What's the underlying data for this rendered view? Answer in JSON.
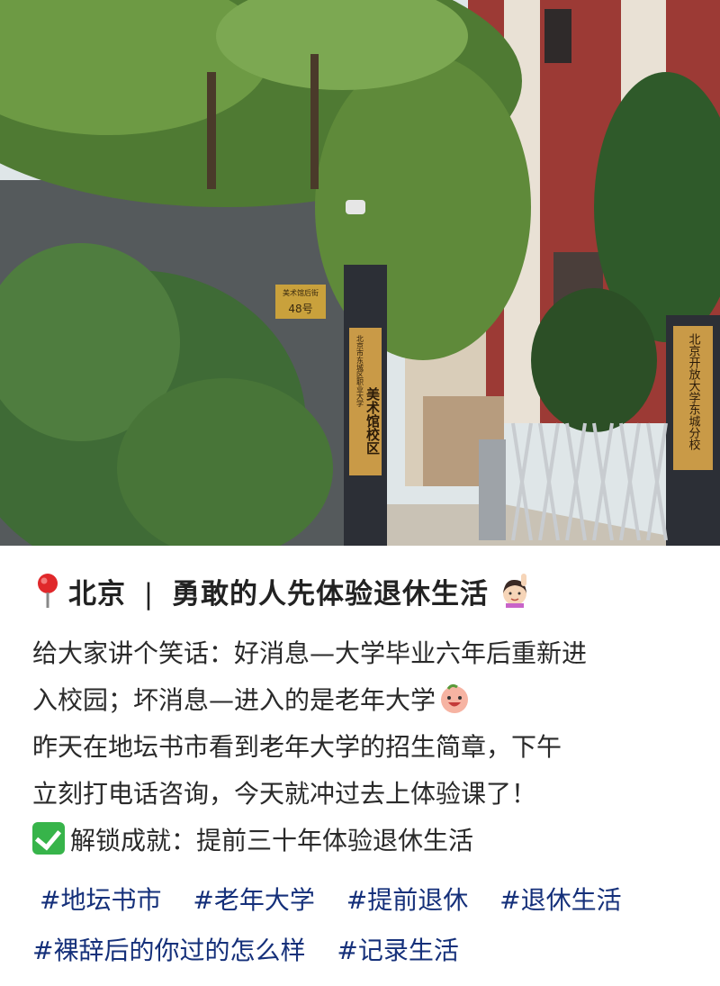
{
  "photo": {
    "address_plate": "48号",
    "address_plate_small": "美术馆后街",
    "left_sign_top": "北京市东城区职业大学",
    "left_sign_main": "美术馆校区",
    "right_sign": "北京开放大学东城分校"
  },
  "post": {
    "location": "北京",
    "separator": "|",
    "title": "勇敢的人先体验退休生活",
    "lines": [
      "给大家讲个笑话：好消息—大学毕业六年后重新进",
      "入校园；坏消息—进入的是老年大学",
      "昨天在地坛书市看到老年大学的招生简章，下午",
      "立刻打电话咨询，今天就冲过去上体验课了！",
      "解锁成就：提前三十年体验退休生活"
    ],
    "tags": [
      "#地坛书市",
      "#老年大学",
      "#提前退休",
      "#退休生活",
      "#裸辞后的你过的怎么样",
      "#记录生活"
    ]
  },
  "icons": [
    "location-pin-icon",
    "woman-raising-hand-emoji",
    "smiling-face-emoji",
    "check-mark-icon"
  ]
}
